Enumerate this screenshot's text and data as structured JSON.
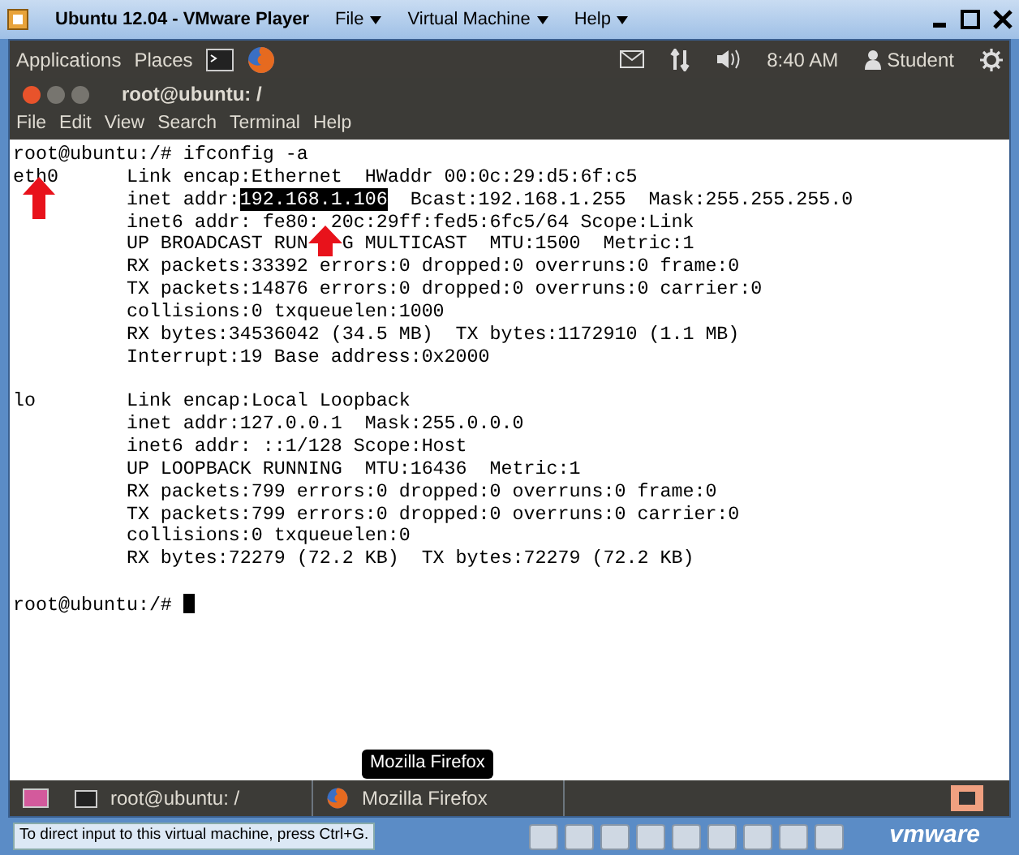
{
  "vm_window": {
    "title": "Ubuntu 12.04 - VMware Player",
    "menus": [
      "File",
      "Virtual Machine",
      "Help"
    ]
  },
  "top_panel": {
    "menus": [
      "Applications",
      "Places"
    ],
    "clock": "8:40 AM",
    "user": "Student"
  },
  "terminal": {
    "title": "root@ubuntu: /",
    "menus": [
      "File",
      "Edit",
      "View",
      "Search",
      "Terminal",
      "Help"
    ],
    "lines": [
      {
        "kind": "text",
        "segments": [
          {
            "text": "root@ubuntu:/# ifconfig -a",
            "selected": false
          }
        ]
      },
      {
        "kind": "text",
        "segments": [
          {
            "text": "eth0      Link encap:Ethernet  HWaddr 00:0c:29:d5:6f:c5",
            "selected": false
          }
        ]
      },
      {
        "kind": "text",
        "segments": [
          {
            "text": "          inet addr:",
            "selected": false
          },
          {
            "text": "192.168.1.106",
            "selected": true
          },
          {
            "text": "  Bcast:192.168.1.255  Mask:255.255.255.0",
            "selected": false
          }
        ]
      },
      {
        "kind": "split",
        "segments": [
          {
            "text": "          inet6 addr: fe80:",
            "selected": false
          },
          {
            "text": " 20c:29ff:fed5:6fc5/64 Scope:Link",
            "selected": false
          }
        ]
      },
      {
        "kind": "split",
        "segments": [
          {
            "text": "          UP BROADCAST RUN",
            "selected": false
          },
          {
            "text": "   G MULTICAST  MTU:1500  Metric:1",
            "selected": false
          }
        ]
      },
      {
        "kind": "text",
        "segments": [
          {
            "text": "          RX packets:33392 errors:0 dropped:0 overruns:0 frame:0",
            "selected": false
          }
        ]
      },
      {
        "kind": "text",
        "segments": [
          {
            "text": "          TX packets:14876 errors:0 dropped:0 overruns:0 carrier:0",
            "selected": false
          }
        ]
      },
      {
        "kind": "text",
        "segments": [
          {
            "text": "          collisions:0 txqueuelen:1000",
            "selected": false
          }
        ]
      },
      {
        "kind": "text",
        "segments": [
          {
            "text": "          RX bytes:34536042 (34.5 MB)  TX bytes:1172910 (1.1 MB)",
            "selected": false
          }
        ]
      },
      {
        "kind": "text",
        "segments": [
          {
            "text": "          Interrupt:19 Base address:0x2000",
            "selected": false
          }
        ]
      },
      {
        "kind": "blank"
      },
      {
        "kind": "text",
        "segments": [
          {
            "text": "lo        Link encap:Local Loopback",
            "selected": false
          }
        ]
      },
      {
        "kind": "text",
        "segments": [
          {
            "text": "          inet addr:127.0.0.1  Mask:255.0.0.0",
            "selected": false
          }
        ]
      },
      {
        "kind": "text",
        "segments": [
          {
            "text": "          inet6 addr: ::1/128 Scope:Host",
            "selected": false
          }
        ]
      },
      {
        "kind": "text",
        "segments": [
          {
            "text": "          UP LOOPBACK RUNNING  MTU:16436  Metric:1",
            "selected": false
          }
        ]
      },
      {
        "kind": "text",
        "segments": [
          {
            "text": "          RX packets:799 errors:0 dropped:0 overruns:0 frame:0",
            "selected": false
          }
        ]
      },
      {
        "kind": "text",
        "segments": [
          {
            "text": "          TX packets:799 errors:0 dropped:0 overruns:0 carrier:0",
            "selected": false
          }
        ]
      },
      {
        "kind": "text",
        "segments": [
          {
            "text": "          collisions:0 txqueuelen:0",
            "selected": false
          }
        ]
      },
      {
        "kind": "text",
        "segments": [
          {
            "text": "          RX bytes:72279 (72.2 KB)  TX bytes:72279 (72.2 KB)",
            "selected": false
          }
        ]
      },
      {
        "kind": "blank"
      },
      {
        "kind": "prompt",
        "segments": [
          {
            "text": "root@ubuntu:/# ",
            "selected": false
          }
        ]
      }
    ]
  },
  "tooltip": "Mozilla Firefox",
  "taskbar": {
    "items": [
      {
        "kind": "terminal",
        "label": "root@ubuntu: /"
      },
      {
        "kind": "firefox",
        "label": "Mozilla Firefox"
      }
    ]
  },
  "status_bar": {
    "message": "To direct input to this virtual machine, press Ctrl+G.",
    "brand": "vmware"
  }
}
